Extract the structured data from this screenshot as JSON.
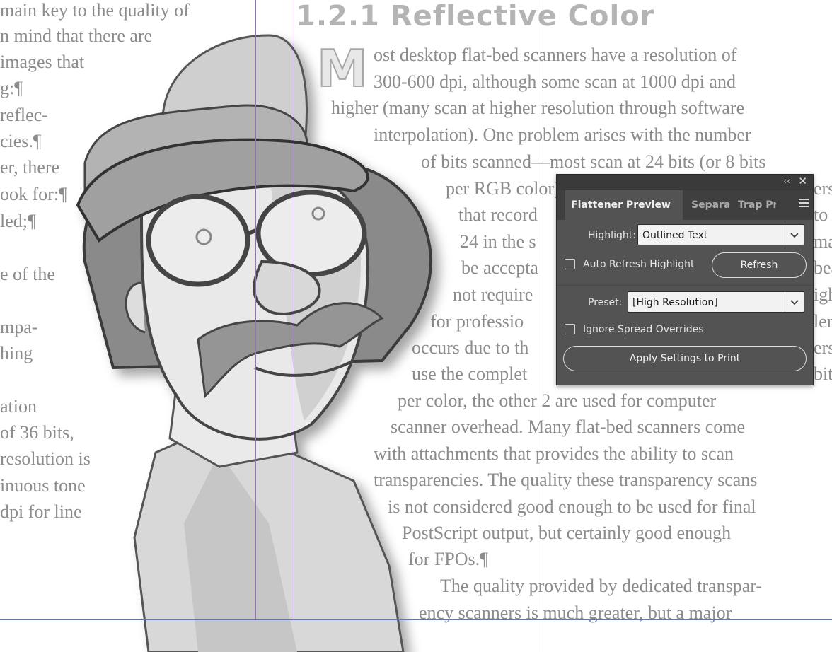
{
  "document": {
    "heading": "1.2.1  Reflective Color",
    "drop_cap": "M",
    "left_column_lines": [
      "main key to the quality of",
      "n mind that there are",
      "images that",
      "g:¶",
      "reflec-",
      "cies.¶",
      "er, there",
      "ook for:¶",
      "led;¶",
      "",
      "e of the",
      "",
      "mpa-",
      "hing",
      "",
      "ation",
      "of 36 bits,",
      "resolution is",
      "inuous tone",
      "dpi for line"
    ],
    "right_column_lines": [
      "ost desktop flat-bed scanners have a resolution of",
      "300-600 dpi, although some scan at 1000 dpi and",
      "higher (many scan at higher resolution through software",
      "interpolation). One problem arises with the number",
      "of bits scanned—most scan at 24 bits (or 8 bits",
      "per RGB color)",
      "that record",
      "24 in the s",
      "be accepta",
      "not require",
      "for professio",
      "occurs due to th",
      "use the complet",
      "per color, the other 2 are used for computer",
      "scanner overhead. Many flat-bed scanners come",
      "with attachments that provides the ability to scan",
      "transparencies. The quality these transparency scans",
      "is not considered good enough to be used for final",
      "PostScript output, but certainly good enough",
      "for FPOs.¶",
      "The quality provided by dedicated transpar-",
      "ency scanners is much greater, but a major"
    ],
    "right_edge_fragments": [
      "ers",
      "to",
      "may",
      "bea",
      "igh",
      "lem",
      "ers",
      "bits"
    ]
  },
  "panel": {
    "tabs": [
      {
        "label": "Flattener Preview",
        "active": true
      },
      {
        "label": "Separations",
        "active": false
      },
      {
        "label": "Trap Presets",
        "active": false
      }
    ],
    "highlight_label": "Highlight:",
    "highlight_value": "Outlined Text",
    "auto_refresh_label": "Auto Refresh Highlight",
    "auto_refresh_checked": false,
    "refresh_button": "Refresh",
    "preset_label": "Preset:",
    "preset_value": "[High Resolution]",
    "ignore_spread_label": "Ignore Spread Overrides",
    "ignore_spread_checked": false,
    "apply_button": "Apply Settings to Print",
    "icons": {
      "collapse": "double-chevron-left-icon",
      "close": "close-icon",
      "menu": "hamburger-menu-icon"
    }
  },
  "colors": {
    "panel_bg": "#535353",
    "guide_purple": "#9a6ad0",
    "guide_blue": "#4a7bd0",
    "text_gray": "#8c8c8c"
  }
}
